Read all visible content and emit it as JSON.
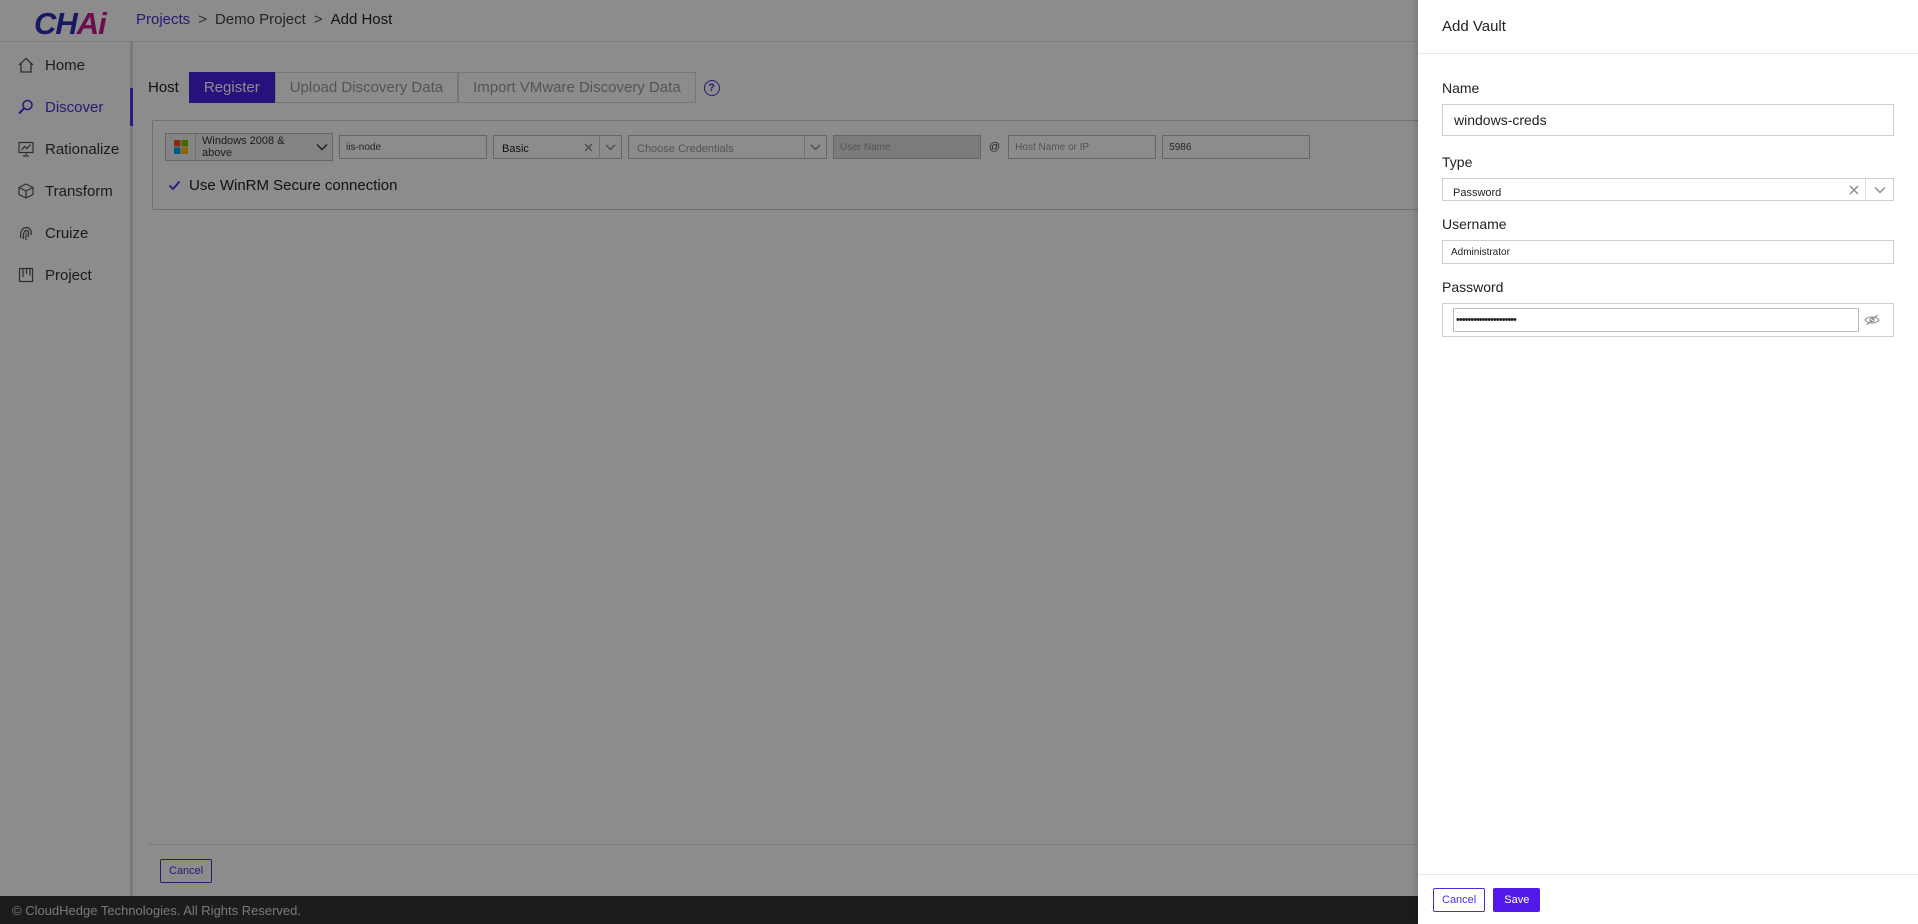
{
  "app": {
    "logo": {
      "main": "CH",
      "accent": "Ai"
    },
    "breadcrumb": {
      "projects": "Projects",
      "project": "Demo Project",
      "current": "Add Host",
      "separator": ">"
    },
    "colors": {
      "brand": "#4a1fe0",
      "logo_main": "#2a2fb8",
      "logo_accent": "#c4198f",
      "footer_bg": "#333333"
    }
  },
  "sidebar": {
    "items": [
      {
        "label": "Home",
        "icon": "home-icon"
      },
      {
        "label": "Discover",
        "icon": "discover-icon",
        "active": true
      },
      {
        "label": "Rationalize",
        "icon": "rationalize-icon"
      },
      {
        "label": "Transform",
        "icon": "cube-icon"
      },
      {
        "label": "Cruize",
        "icon": "fingerprint-icon"
      },
      {
        "label": "Project",
        "icon": "board-icon"
      }
    ]
  },
  "host_tabs": {
    "label": "Host",
    "tabs": [
      "Register",
      "Upload Discovery Data",
      "Import VMware Discovery Data"
    ]
  },
  "register_form": {
    "os": "Windows 2008 & above",
    "host_alias": "iis-node",
    "auth_type": "Basic",
    "credentials_placeholder": "Choose Credentials",
    "username_placeholder": "User Name",
    "at": "@",
    "host_placeholder": "Host Name or IP",
    "port": "5986",
    "winrm_label": "Use WinRM Secure connection"
  },
  "main_footer": {
    "cancel": "Cancel"
  },
  "footer": {
    "copyright": "© CloudHedge Technologies. All Rights Reserved."
  },
  "drawer": {
    "title": "Add Vault",
    "name_label": "Name",
    "name_value": "windows-creds",
    "type_label": "Type",
    "type_value": "Password",
    "username_label": "Username",
    "username_value": "Administrator",
    "password_label": "Password",
    "password_value": "•••••••••••••••••••••",
    "cancel": "Cancel",
    "save": "Save"
  }
}
